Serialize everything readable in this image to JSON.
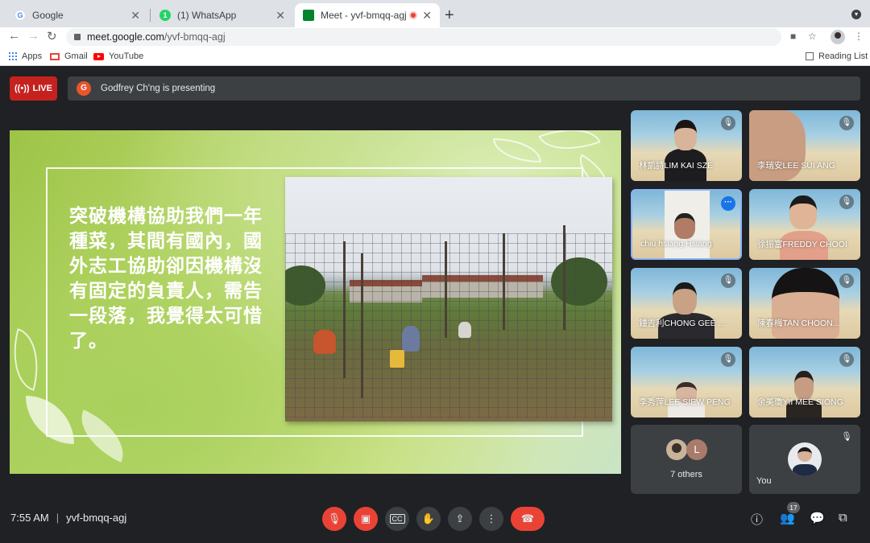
{
  "browser": {
    "tabs": [
      {
        "title": "Google",
        "favicon": "google-g-icon",
        "favicon_color": "#4285f4"
      },
      {
        "title": "(1) WhatsApp",
        "favicon": "whatsapp-icon",
        "favicon_color": "#25d366"
      },
      {
        "title": "Meet - yvf-bmqq-agj",
        "favicon": "meet-icon",
        "favicon_color": "#00832d",
        "recording": true
      }
    ],
    "url_host": "meet.google.com",
    "url_path": "/yvf-bmqq-agj",
    "bookmarks": [
      {
        "label": "Apps",
        "icon": "apps-grid-icon"
      },
      {
        "label": "Gmail",
        "icon": "gmail-icon"
      },
      {
        "label": "YouTube",
        "icon": "youtube-icon"
      }
    ],
    "reading_list": "Reading List"
  },
  "meet": {
    "live_label": "LIVE",
    "presenter_initial": "G",
    "presenting_text": "Godfrey Ch'ng is presenting",
    "slide_text": "突破機構協助我們一年種菜，其間有國內，國外志工協助卻因機構沒有固定的負責人，需告一段落，我覺得太可惜了。",
    "participants": [
      {
        "name": "林凱詩LIM KAI SZE",
        "muted": true
      },
      {
        "name": "李瑞安LEE SUI ANG",
        "muted": true
      },
      {
        "name": "chiu hsiang Hsiang",
        "muted": false,
        "selected": true
      },
      {
        "name": "徐振富FREDDY CHOOI",
        "muted": true
      },
      {
        "name": "鍾吉利CHONG GEE ...",
        "muted": true
      },
      {
        "name": "陳春梅TAN CHOON...",
        "muted": true
      },
      {
        "name": "李秀萍LEE SIEW PENG",
        "muted": true
      },
      {
        "name": "余美瓊YII MEE SIONG",
        "muted": true
      }
    ],
    "others": {
      "initial": "L",
      "label": "7 others"
    },
    "you_label": "You",
    "time": "7:55 AM",
    "meeting_code": "yvf-bmqq-agj",
    "people_count": "17",
    "colors": {
      "live": "#c5221f",
      "end_call": "#ea4335",
      "accent": "#8ab4f8",
      "background": "#202124"
    }
  }
}
